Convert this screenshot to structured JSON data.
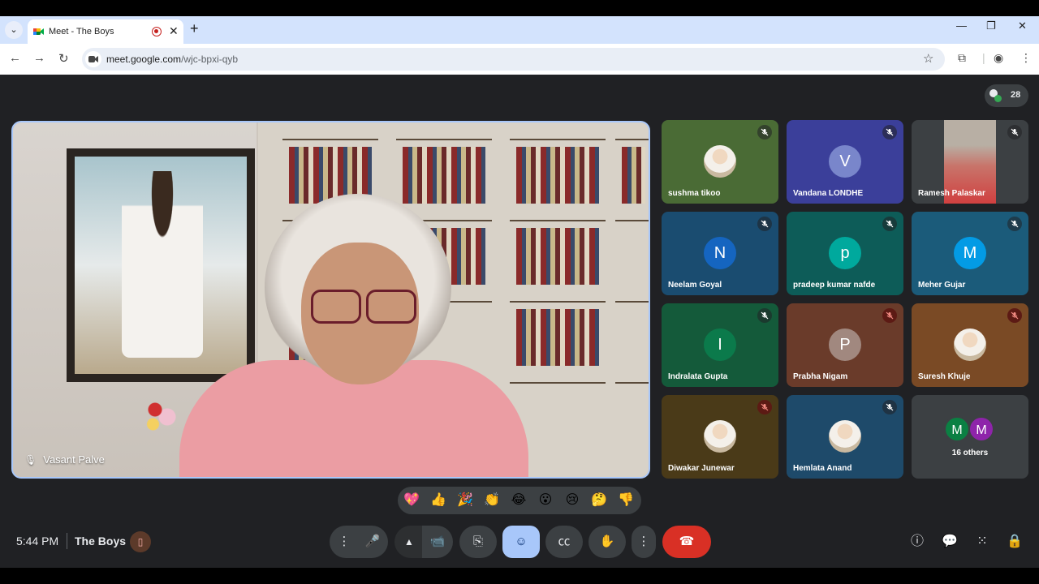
{
  "browser": {
    "tab_title": "Meet - The Boys",
    "tab_close": "✕",
    "new_tab": "+",
    "url_host": "meet.google.com",
    "url_path": "/wjc-bpxi-qyb",
    "menu_chevron": "⌄",
    "minimize": "—",
    "restore": "❐",
    "close": "✕"
  },
  "meet": {
    "participant_count": "28",
    "main_speaker": {
      "name": "Vasant Palve"
    },
    "tiles": [
      {
        "name": "sushma tikoo",
        "type": "photo",
        "muted": true,
        "bg": "#4a6b35"
      },
      {
        "name": "Vandana LONDHE",
        "type": "letter",
        "letter": "V",
        "muted": true,
        "bg": "#3b3f9a",
        "avatar_bg": "#7986cb"
      },
      {
        "name": "Ramesh Palaskar",
        "type": "video",
        "muted": true,
        "bg": "#3c4043"
      },
      {
        "name": "Neelam Goyal",
        "type": "letter",
        "letter": "N",
        "muted": true,
        "bg": "#1a4c70",
        "avatar_bg": "#1565c0"
      },
      {
        "name": "pradeep kumar nafde",
        "type": "letter",
        "letter": "p",
        "muted": true,
        "bg": "#0d5c58",
        "avatar_bg": "#00a99d"
      },
      {
        "name": "Meher Gujar",
        "type": "letter",
        "letter": "M",
        "muted": true,
        "bg": "#1b5b7a",
        "avatar_bg": "#039be5"
      },
      {
        "name": "Indralata Gupta",
        "type": "letter",
        "letter": "I",
        "muted": true,
        "bg": "#145a3a",
        "avatar_bg": "#0b7a4b"
      },
      {
        "name": "Prabha Nigam",
        "type": "letter",
        "letter": "P",
        "muted": true,
        "bg": "#6a3b2a",
        "avatar_bg": "#a1887f"
      },
      {
        "name": "Suresh Khuje",
        "type": "photo",
        "muted": true,
        "bg": "#7a4a25"
      },
      {
        "name": "Diwakar Junewar",
        "type": "photo",
        "muted": true,
        "bg": "#4a3a18"
      },
      {
        "name": "Hemlata Anand",
        "type": "photo",
        "muted": true,
        "bg": "#1e4a6a"
      }
    ],
    "others": {
      "label": "16 others",
      "letters": [
        "M",
        "M"
      ],
      "colors": [
        "#0b8043",
        "#8e24aa"
      ]
    },
    "reactions": [
      "💖",
      "👍",
      "🎉",
      "👏",
      "😂",
      "😮",
      "😢",
      "🤔",
      "👎"
    ],
    "time": "5:44 PM",
    "meeting_name": "The Boys"
  },
  "colors": {
    "stage": "#202124",
    "accent": "#a8c7fa",
    "end_call": "#d93025"
  }
}
